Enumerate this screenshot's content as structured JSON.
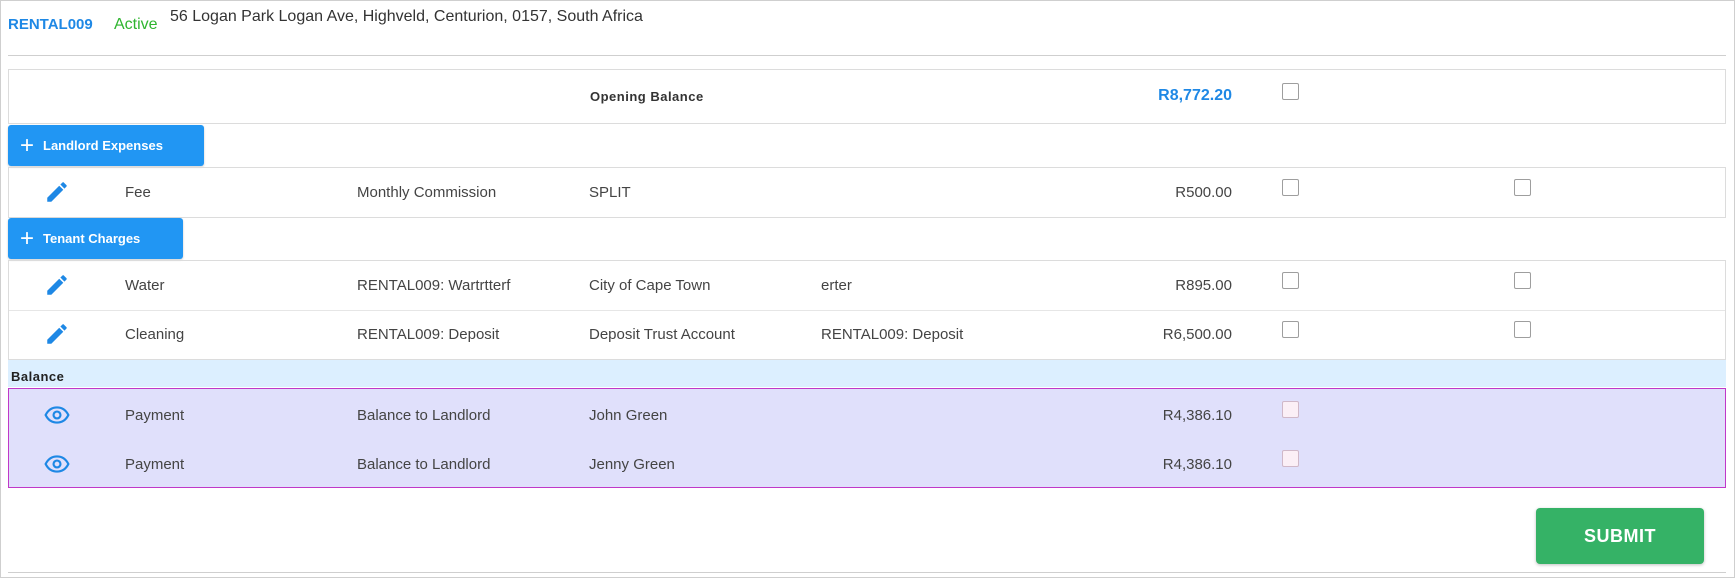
{
  "header": {
    "ref": "RENTAL009",
    "status": "Active",
    "address": "56 Logan Park Logan Ave, Highveld, Centurion, 0157, South Africa"
  },
  "opening": {
    "label": "Opening Balance",
    "amount": "R8,772.20"
  },
  "landlord_expenses": {
    "button_label": "Landlord Expenses",
    "rows": [
      {
        "type": "Fee",
        "description": "Monthly Commission",
        "party": "SPLIT",
        "reference": "",
        "amount": "R500.00"
      }
    ]
  },
  "tenant_charges": {
    "button_label": "Tenant Charges",
    "rows": [
      {
        "type": "Water",
        "description": "RENTAL009: Wartrtterf",
        "party": "City of Cape Town",
        "reference": "erter",
        "amount": "R895.00"
      },
      {
        "type": "Cleaning",
        "description": "RENTAL009: Deposit",
        "party": "Deposit Trust Account",
        "reference": "RENTAL009: Deposit",
        "amount": "R6,500.00"
      }
    ]
  },
  "balance": {
    "label": "Balance",
    "rows": [
      {
        "type": "Payment",
        "description": "Balance to Landlord",
        "party": "John Green",
        "amount": "R4,386.10"
      },
      {
        "type": "Payment",
        "description": "Balance to Landlord",
        "party": "Jenny Green",
        "amount": "R4,386.10"
      }
    ]
  },
  "submit_label": "SUBMIT",
  "colors": {
    "accent": "#1e88e5",
    "active": "#2fb52f",
    "submit": "#35b266",
    "balance_band": "#dcefff",
    "balance_rows": "#e0e0fb",
    "highlight_border": "#c038c8"
  }
}
